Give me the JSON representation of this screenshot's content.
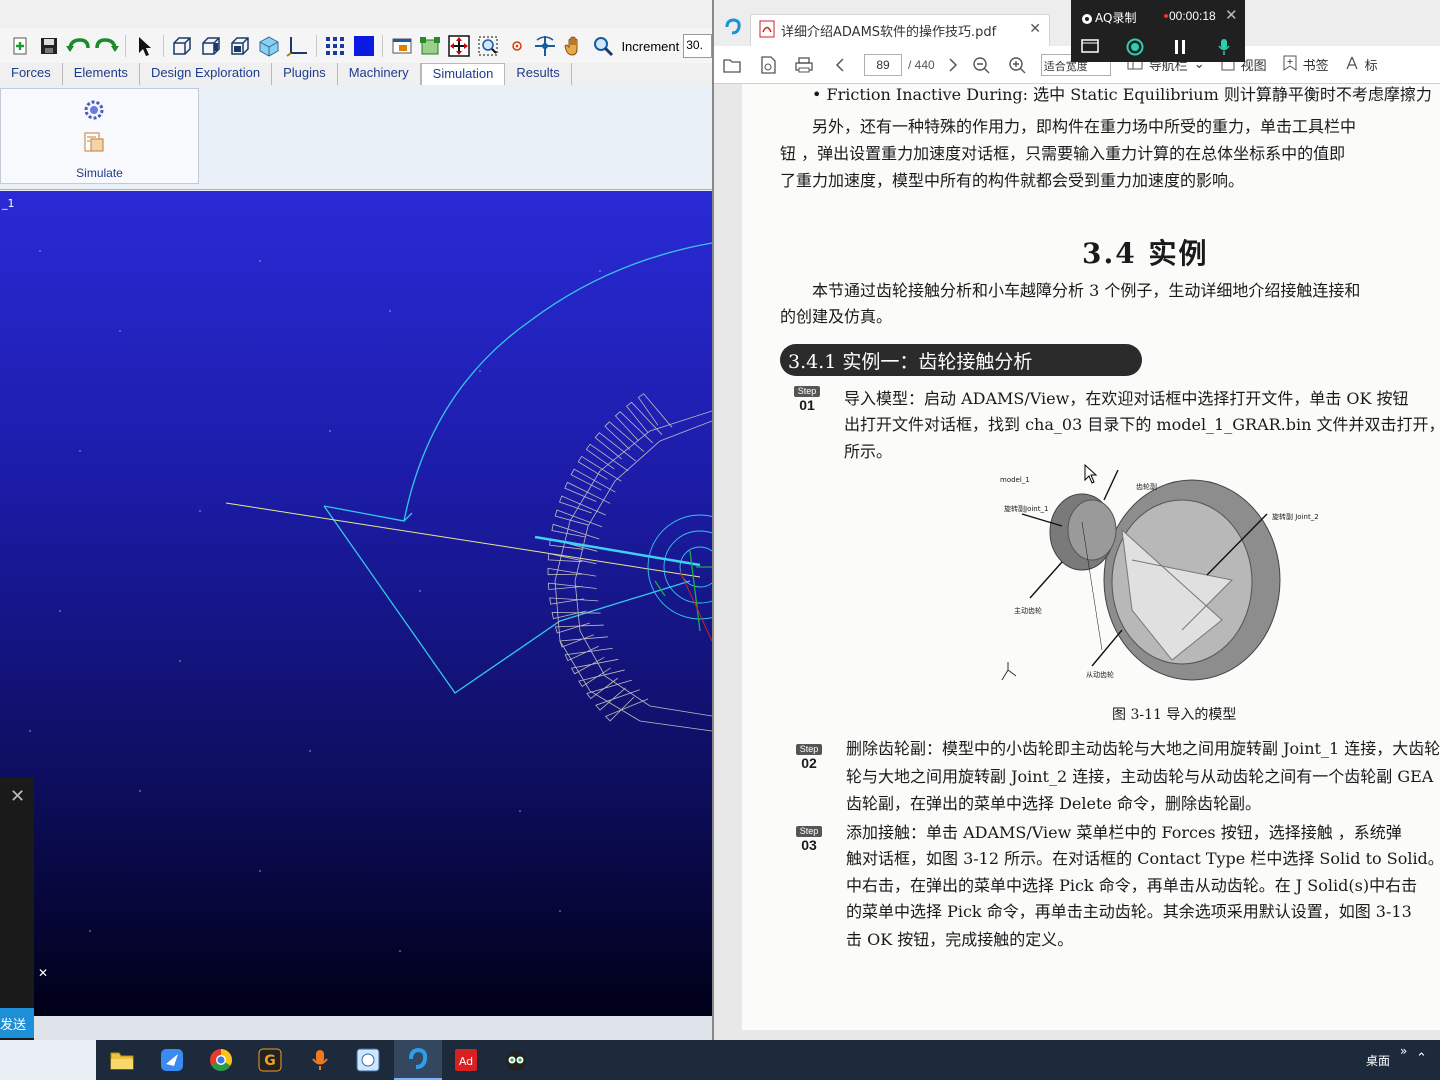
{
  "adams": {
    "toolbar": {
      "increment_label": "Increment",
      "increment_value": "30."
    },
    "tabs": [
      {
        "label": "Forces"
      },
      {
        "label": "Elements"
      },
      {
        "label": "Design Exploration"
      },
      {
        "label": "Plugins"
      },
      {
        "label": "Machinery"
      },
      {
        "label": "Simulation"
      },
      {
        "label": "Results"
      }
    ],
    "active_tab": "Simulation",
    "ribbon": {
      "simulate_label": "Simulate"
    },
    "viewport": {
      "model_label": "_1"
    },
    "send_button": "发送"
  },
  "pdf": {
    "tab_title": "详细介绍ADAMS软件的操作技巧.pdf",
    "page_current": "89",
    "page_total": "/ 440",
    "fit_mode": "适合宽度",
    "nav_pane": "导航栏",
    "view_label": "视图",
    "bookmark_label": "书签",
    "annot_label": "标",
    "content": {
      "line1": "•  Friction Inactive During: 选中 Static Equilibrium 则计算静平衡时不考虑摩擦力",
      "para1_l1": "另外，还有一种特殊的作用力，即构件在重力场中所受的重力，单击工具栏中",
      "para1_l2": "钮 ，弹出设置重力加速度对话框，只需要输入重力计算的在总体坐标系中的值即",
      "para1_l3": "了重力加速度，模型中所有的构件就都会受到重力加速度的影响。",
      "section_title": "3.4    实例",
      "para2_l1": "本节通过齿轮接触分析和小车越障分析 3 个例子，生动详细地介绍接触连接和",
      "para2_l2": "的创建及仿真。",
      "example_banner": "3.4.1    实例一：齿轮接触分析",
      "step_word": "Step",
      "step1_num": "01",
      "step1_l1": "导入模型：启动 ADAMS/View，在欢迎对话框中选择打开文件，单击 OK 按钮",
      "step1_l2": "出打开文件对话框，找到 cha_03 目录下的 model_1_GRAR.bin 文件并双击打开，",
      "step1_l3": "所示。",
      "fig_caption": "图 3-11    导入的模型",
      "fig_labels": {
        "model": "model_1",
        "joint1": "旋转副Joint_1",
        "gear_pair": "齿轮副",
        "joint2": "旋转副 Joint_2",
        "driver": "主动齿轮",
        "driven": "从动齿轮"
      },
      "step2_num": "02",
      "step2_l1": "删除齿轮副：模型中的小齿轮即主动齿轮与大地之间用旋转副 Joint_1 连接，大齿轮",
      "step2_l2": "轮与大地之间用旋转副 Joint_2 连接，主动齿轮与从动齿轮之间有一个齿轮副 GEA",
      "step2_l3": "齿轮副，在弹出的菜单中选择 Delete 命令，删除齿轮副。",
      "step3_num": "03",
      "step3_l1": "添加接触：单击 ADAMS/View 菜单栏中的 Forces 按钮，选择接触 ，系统弹",
      "step3_l2": "触对话框，如图 3-12 所示。在对话框的 Contact Type 栏中选择 Solid to Solid。在",
      "step3_l3": "中右击，在弹出的菜单中选择 Pick 命令，再单击从动齿轮。在 J Solid(s)中右击",
      "step3_l4": "的菜单中选择 Pick 命令，再单击主动齿轮。其余选项采用默认设置，如图 3-13",
      "step3_l5": "击 OK 按钮，完成接触的定义。"
    }
  },
  "recorder": {
    "title": "AQ录制",
    "time": "00:00:18"
  },
  "taskbar": {
    "desktop_label": "桌面"
  },
  "colors": {
    "viewport_top": "#2a2ad6",
    "wireframe_cyan": "#35c8e8",
    "gear_gray": "#bdbdbd",
    "accent_blue": "#1e90d8"
  }
}
